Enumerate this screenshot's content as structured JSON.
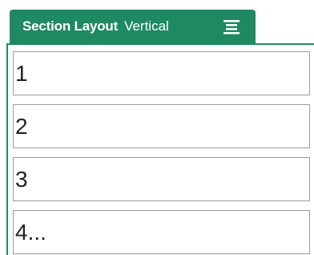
{
  "section": {
    "title": "Section Layout",
    "layout_mode": "Vertical",
    "menu_icon": "hamburger-menu-icon",
    "accent_color": "#1e8a62"
  },
  "items": [
    {
      "value": "1"
    },
    {
      "value": "2"
    },
    {
      "value": "3"
    },
    {
      "value": "4..."
    }
  ]
}
